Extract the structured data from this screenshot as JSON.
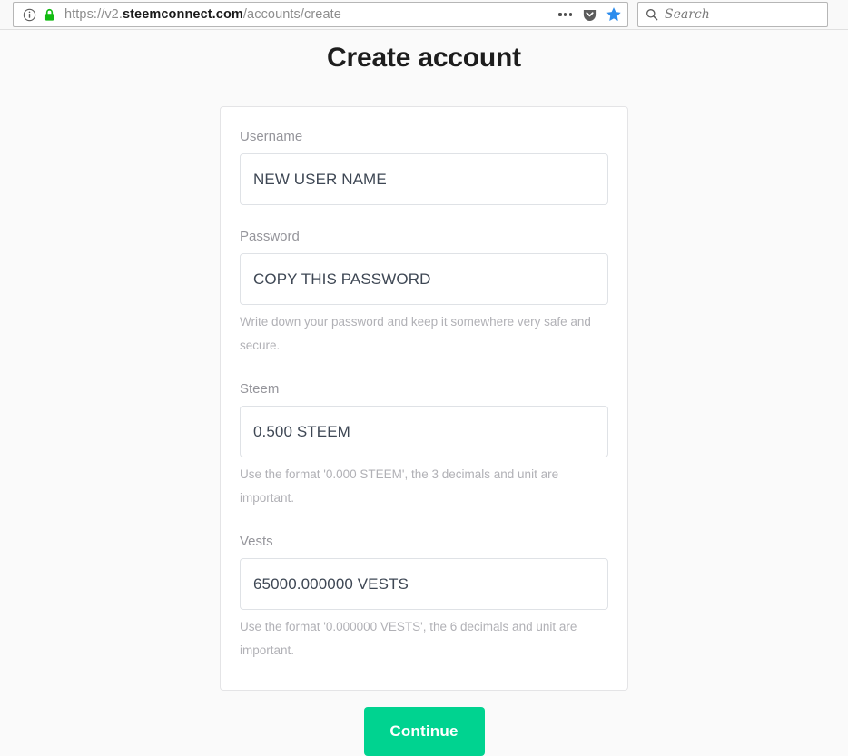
{
  "browser": {
    "url": {
      "scheme": "https://v2.",
      "host": "steemconnect.com",
      "path": "/accounts/create",
      "full": "https://v2.steemconnect.com/accounts/create"
    },
    "search": {
      "placeholder": "Search"
    },
    "icons": {
      "info": "info-icon",
      "lock": "lock-icon",
      "page_actions": "ellipsis-icon",
      "pocket": "pocket-icon",
      "bookmark": "star-icon",
      "search": "search-icon"
    },
    "colors": {
      "lock_green": "#12bb12",
      "star_blue": "#2b8ced",
      "pocket_gray": "#5b5b5b"
    }
  },
  "page": {
    "title": "Create account",
    "accent_color": "#00d390",
    "background": "#fafafa"
  },
  "form": {
    "fields": [
      {
        "label": "Username",
        "value": "NEW USER NAME",
        "placeholder": "NEW USER NAME",
        "help": ""
      },
      {
        "label": "Password",
        "value": "COPY THIS PASSWORD",
        "placeholder": "COPY THIS PASSWORD",
        "help": "Write down your password and keep it somewhere very safe and secure."
      },
      {
        "label": "Steem",
        "value": "0.500 STEEM",
        "placeholder": "0.500 STEEM",
        "help": "Use the format '0.000 STEEM', the 3 decimals and unit are important."
      },
      {
        "label": "Vests",
        "value": "65000.000000 VESTS",
        "placeholder": "65000.000000 VESTS",
        "help": "Use the format '0.000000 VESTS', the 6 decimals and unit are important."
      }
    ],
    "submit_label": "Continue"
  }
}
